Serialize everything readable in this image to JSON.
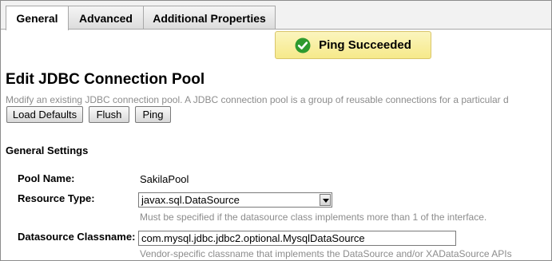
{
  "tabs": [
    {
      "label": "General",
      "active": true
    },
    {
      "label": "Advanced",
      "active": false
    },
    {
      "label": "Additional Properties",
      "active": false
    }
  ],
  "status": {
    "message": "Ping Succeeded",
    "icon": "check-circle-icon",
    "color": "#2e9a2e"
  },
  "page": {
    "title": "Edit JDBC Connection Pool",
    "description": "Modify an existing JDBC connection pool. A JDBC connection pool is a group of reusable connections for a particular d"
  },
  "buttons": {
    "load_defaults": "Load Defaults",
    "flush": "Flush",
    "ping": "Ping"
  },
  "section": {
    "title": "General Settings"
  },
  "fields": {
    "pool_name": {
      "label": "Pool Name:",
      "value": "SakilaPool"
    },
    "resource_type": {
      "label": "Resource Type:",
      "value": "javax.sql.DataSource",
      "hint": "Must be specified if the datasource class implements more than 1 of the interface."
    },
    "datasource_classname": {
      "label": "Datasource Classname:",
      "value": "com.mysql.jdbc.jdbc2.optional.MysqlDataSource",
      "hint": "Vendor-specific classname that implements the DataSource and/or XADataSource APIs"
    }
  }
}
